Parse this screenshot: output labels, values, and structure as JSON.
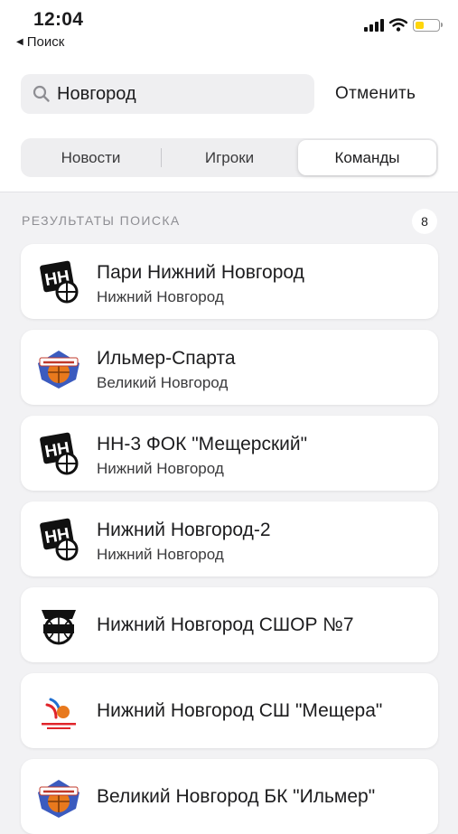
{
  "status_bar": {
    "time": "12:04",
    "back_label": "Поиск"
  },
  "search": {
    "value": "Новгород",
    "cancel_label": "Отменить"
  },
  "tabs": [
    {
      "label": "Новости",
      "selected": false
    },
    {
      "label": "Игроки",
      "selected": false
    },
    {
      "label": "Команды",
      "selected": true
    }
  ],
  "results": {
    "header": "РЕЗУЛЬТАТЫ ПОИСКА",
    "count": "8",
    "items": [
      {
        "name": "Пари Нижний Новгород",
        "city": "Нижний Новгород",
        "logo": "nn-logo-icon"
      },
      {
        "name": "Ильмер-Спарта",
        "city": "Великий Новгород",
        "logo": "ilmer-logo-icon"
      },
      {
        "name": "НН-3 ФОК \"Мещерский\"",
        "city": "Нижний Новгород",
        "logo": "nn-logo-icon"
      },
      {
        "name": "Нижний Новгород-2",
        "city": "Нижний Новгород",
        "logo": "nn-logo-icon"
      },
      {
        "name": "Нижний Новгород СШОР №7",
        "city": "",
        "logo": "sshor-logo-icon"
      },
      {
        "name": "Нижний Новгород СШ \"Мещера\"",
        "city": "",
        "logo": "meshchera-logo-icon"
      },
      {
        "name": "Великий Новгород БК \"Ильмер\"",
        "city": "",
        "logo": "ilmer-logo-icon"
      }
    ]
  },
  "colors": {
    "background": "#f2f2f4",
    "battery": "#ffd60a",
    "orange": "#e8791d",
    "blue": "#3b5bbf"
  }
}
